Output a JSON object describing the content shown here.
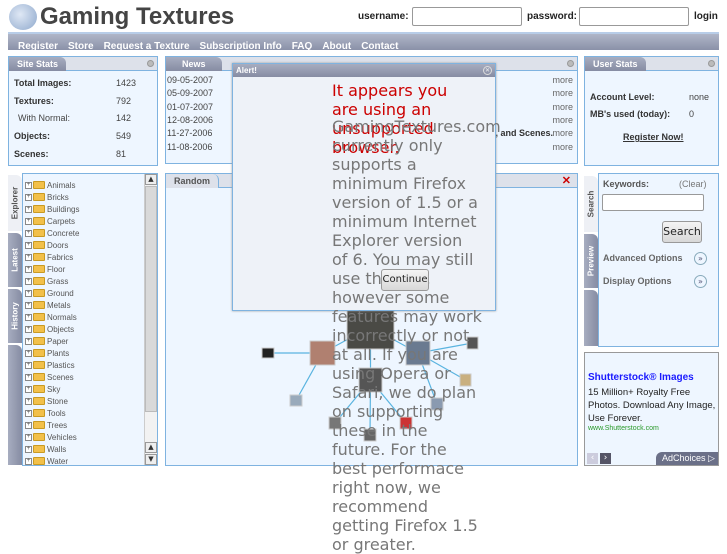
{
  "header": {
    "title": "Gaming Textures",
    "username_label": "username:",
    "password_label": "password:",
    "login_label": "login",
    "username_value": "",
    "password_value": ""
  },
  "nav": [
    "Register",
    "Store",
    "Request a Texture",
    "Subscription Info",
    "FAQ",
    "About",
    "Contact"
  ],
  "site_stats": {
    "title": "Site Stats",
    "rows": [
      {
        "label": "Total Images:",
        "value": "1423"
      },
      {
        "label": "Textures:",
        "value": "792"
      },
      {
        "label": "With Normal:",
        "value": "142"
      },
      {
        "label": "Objects:",
        "value": "549"
      },
      {
        "label": "Scenes:",
        "value": "81"
      }
    ]
  },
  "news": {
    "title": "News",
    "items": [
      {
        "date": "09-05-2007",
        "text": "",
        "more": "more"
      },
      {
        "date": "05-09-2007",
        "text": "",
        "more": "more"
      },
      {
        "date": "01-07-2007",
        "text": "",
        "more": "more"
      },
      {
        "date": "12-08-2006",
        "text": "",
        "more": "more"
      },
      {
        "date": "11-27-2006",
        "text": "s, and Scenes.",
        "more": "more"
      },
      {
        "date": "11-08-2006",
        "text": "",
        "more": "more"
      }
    ]
  },
  "user_stats": {
    "title": "User Stats",
    "account_label": "Account Level:",
    "account_value": "none",
    "mb_label": "MB's used (today):",
    "mb_value": "0",
    "register_link": "Register Now!"
  },
  "explorer": {
    "tabs": [
      "Explorer",
      "Latest",
      "History"
    ],
    "items": [
      "Animals",
      "Bricks",
      "Buildings",
      "Carpets",
      "Concrete",
      "Doors",
      "Fabrics",
      "Floor",
      "Grass",
      "Ground",
      "Metals",
      "Normals",
      "Objects",
      "Paper",
      "Plants",
      "Plastics",
      "Scenes",
      "Sky",
      "Stone",
      "Tools",
      "Trees",
      "Vehicles",
      "Walls",
      "Water"
    ]
  },
  "random": {
    "title": "Random"
  },
  "search": {
    "tabs": [
      "Search",
      "Preview"
    ],
    "keywords_label": "Keywords:",
    "clear_label": "(Clear)",
    "keywords_value": "",
    "search_button": "Search",
    "advanced": "Advanced Options",
    "display": "Display Options"
  },
  "ad": {
    "title": "Shutterstock® Images",
    "body": "15 Million+ Royalty Free Photos. Download Any Image, Use Forever.",
    "url": "www.Shutterstock.com",
    "adchoices": "AdChoices"
  },
  "alert": {
    "title": "Alert!",
    "heading": "It appears you are using an unsupported browser.",
    "body": "GamingTextures.com currently only supports a minimum Firefox version of 1.5 or a minimum Internet Explorer version of 6. You may still use the site, however some features may work incorrectly or not at all. If you are using Opera or Safari, we do plan on supporting these in the future. For the best performace right now, we recommend getting Firefox 1.5 or greater.",
    "button": "Continue"
  },
  "colors": {
    "accent": "#7fb3e0",
    "nav": "#8a91a8",
    "alert_red": "#cc0000",
    "ad_link": "#1a1aff",
    "ad_url": "#2a9a2a"
  }
}
